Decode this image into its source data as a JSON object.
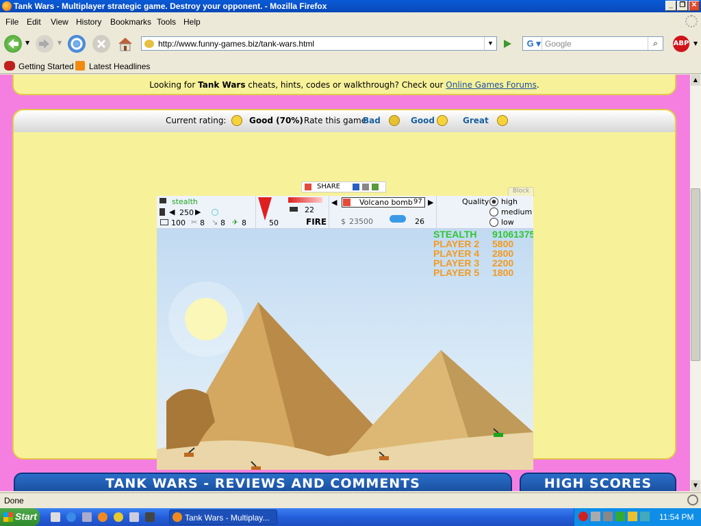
{
  "window": {
    "title": "Tank Wars - Multiplayer strategic game. Destroy your opponent. - Mozilla Firefox"
  },
  "menu": {
    "items": [
      "File",
      "Edit",
      "View",
      "History",
      "Bookmarks",
      "Tools",
      "Help"
    ]
  },
  "nav": {
    "url": "http://www.funny-games.biz/tank-wars.html",
    "search_placeholder": "Google",
    "abp_label": "ABP"
  },
  "bookmarks": {
    "items": [
      "Getting Started",
      "Latest Headlines"
    ]
  },
  "page": {
    "cheats_text_1": "Looking for ",
    "cheats_game": "Tank Wars",
    "cheats_text_2": " cheats, hints, codes or walkthrough? Check our ",
    "cheats_link": "Online Games Forums",
    "cheats_end": ".",
    "rating": {
      "current_label": "Current rating:",
      "current_value": "Good (70%)",
      "rate_label": "Rate this game",
      "options": [
        "Bad",
        "Good",
        "Great"
      ]
    },
    "share_label": "SHARE",
    "block_label": "Block",
    "footer_tabs": [
      "TANK WARS - REVIEWS AND COMMENTS",
      "HIGH SCORES"
    ]
  },
  "game": {
    "player_name": "stealth",
    "angle": "250",
    "health": "100",
    "ammo_a": "8",
    "ammo_b": "8",
    "ammo_c": "8",
    "power": "50",
    "tanks_left": "22",
    "fire_label": "FIRE",
    "weapon": "Volcano bomb",
    "weapon_count": "97",
    "money_symbol": "$",
    "money": "23500",
    "wind": "26",
    "quality_label": "Quality",
    "quality_options": [
      "high",
      "medium",
      "low"
    ],
    "quality_selected": "high",
    "scoreboard": [
      {
        "name": "STEALTH",
        "score": "91061375",
        "color": "#2FC62F"
      },
      {
        "name": "PLAYER 2",
        "score": "5800",
        "color": "#F39A1E"
      },
      {
        "name": "PLAYER 4",
        "score": "2800",
        "color": "#F39A1E"
      },
      {
        "name": "PLAYER 3",
        "score": "2200",
        "color": "#F39A1E"
      },
      {
        "name": "PLAYER 5",
        "score": "1800",
        "color": "#F39A1E"
      }
    ]
  },
  "statusbar": {
    "text": "Done"
  },
  "taskbar": {
    "start_label": "Start",
    "task_label": "Tank Wars - Multiplay...",
    "clock": "11:54 PM"
  }
}
